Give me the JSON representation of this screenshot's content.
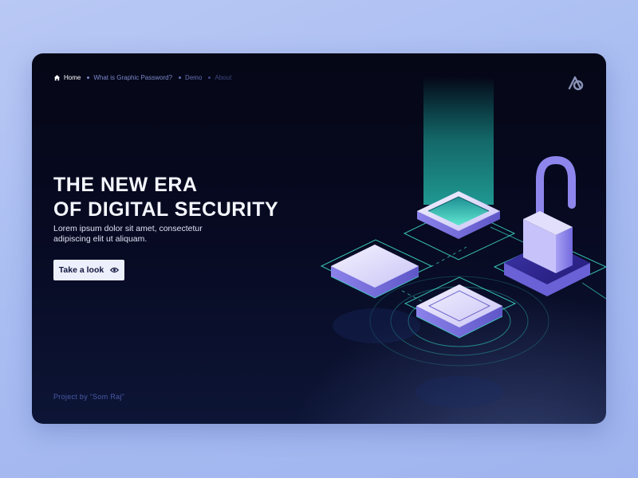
{
  "nav": {
    "items": [
      {
        "label": "Home",
        "icon": "home-icon",
        "active": true
      },
      {
        "label": "What is Graphic Password?"
      },
      {
        "label": "Demo"
      },
      {
        "label": "About"
      }
    ]
  },
  "logo": {
    "icon": "brand-logo-icon"
  },
  "hero": {
    "title_line1": "THE NEW ERA",
    "title_line2": "OF DIGITAL SECURITY",
    "description": "Lorem ipsum dolor sit amet, consectetur adipiscing elit ut aliquam.",
    "cta_label": "Take a look",
    "cta_icon": "eye-icon"
  },
  "footer": {
    "credit": "Project by “Som Raj”"
  },
  "colors": {
    "background": "#a9bdf2",
    "card": "#070a22",
    "accent_teal": "#3fd7c5",
    "accent_violet": "#7b72e6",
    "button_bg": "#eceffc",
    "text_light": "#f4f6ff"
  }
}
